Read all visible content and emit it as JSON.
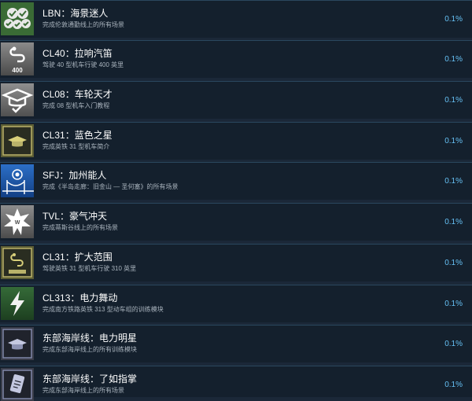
{
  "achievements": [
    {
      "title": "LBN：海景迷人",
      "desc": "完成伦敦通勤线上的所有场景",
      "percent": "0.1%",
      "icon": "triple-check-icon"
    },
    {
      "title": "CL40：拉响汽笛",
      "desc": "驾驶 40 型机车行驶 400 英里",
      "percent": "0.1%",
      "icon": "route-400-icon"
    },
    {
      "title": "CL08：车轮天才",
      "desc": "完成 08 型机车入门教程",
      "percent": "0.1%",
      "icon": "graduation-cap-icon"
    },
    {
      "title": "CL31：蓝色之星",
      "desc": "完成英铁 31 型机车简介",
      "percent": "0.1%",
      "icon": "gold-cap-icon"
    },
    {
      "title": "SFJ：加州能人",
      "desc": "完成《半岛走廊：旧金山 — 圣何塞》的所有场景",
      "percent": "0.1%",
      "icon": "bridge-icon"
    },
    {
      "title": "TVL：豪气冲天",
      "desc": "完成蒂斯谷线上的所有场景",
      "percent": "0.1%",
      "icon": "star-burst-icon"
    },
    {
      "title": "CL31：扩大范围",
      "desc": "驾驶英铁 31 型机车行驶 310 英里",
      "percent": "0.1%",
      "icon": "gold-route-icon"
    },
    {
      "title": "CL313：电力舞动",
      "desc": "完成南方铁路英铁 313 型动车组的训练模块",
      "percent": "0.1%",
      "icon": "lightning-icon"
    },
    {
      "title": "东部海岸线：电力明星",
      "desc": "完成东部海岸线上的所有训练模块",
      "percent": "0.1%",
      "icon": "blue-cap-icon"
    },
    {
      "title": "东部海岸线：了如指掌",
      "desc": "完成东部海岸线上的所有场景",
      "percent": "0.1%",
      "icon": "phone-icon"
    }
  ]
}
